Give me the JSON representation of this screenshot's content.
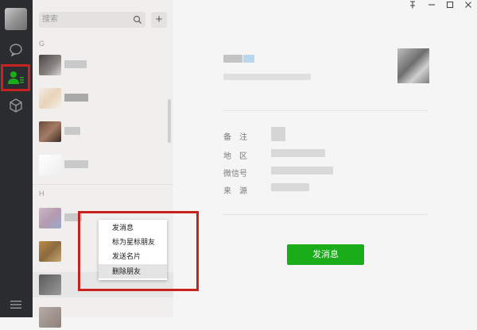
{
  "search": {
    "placeholder": "搜索"
  },
  "list": {
    "groups": [
      {
        "letter": "G"
      },
      {
        "letter": "H"
      }
    ]
  },
  "context_menu": {
    "items": [
      {
        "label": "发消息"
      },
      {
        "label": "标为星标朋友"
      },
      {
        "label": "发送名片"
      },
      {
        "label": "删除朋友"
      }
    ]
  },
  "detail": {
    "fields": [
      {
        "label": "备　注"
      },
      {
        "label": "地　区"
      },
      {
        "label": "微信号"
      },
      {
        "label": "来　源"
      }
    ],
    "send_button": "发消息"
  },
  "colors": {
    "nav_bg": "#2b2c2f",
    "accent_green": "#1aad19",
    "highlight_red": "#c8221e"
  }
}
